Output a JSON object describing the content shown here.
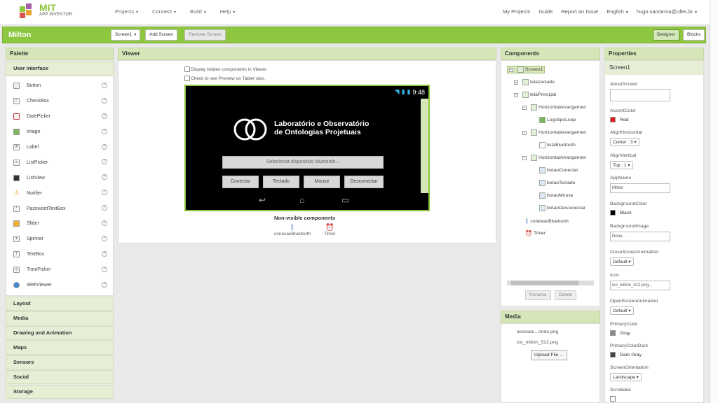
{
  "header": {
    "logo_text": "MIT",
    "logo_sub": "APP INVENTOR",
    "nav_left": [
      "Projects",
      "Connect",
      "Build",
      "Help"
    ],
    "nav_right": [
      "My Projects",
      "Guide",
      "Report an Issue",
      "English",
      "hugo.santanna@ufes.br"
    ]
  },
  "toolbar": {
    "project_name": "Milton",
    "screen_select": "Screen1",
    "add_screen": "Add Screen",
    "remove_screen": "Remove Screen",
    "designer": "Designer",
    "blocks": "Blocks"
  },
  "palette": {
    "title": "Palette",
    "open_category": "User Interface",
    "items": [
      {
        "label": "Button",
        "icon": "button-icon"
      },
      {
        "label": "CheckBox",
        "icon": "checkbox-icon"
      },
      {
        "label": "DatePicker",
        "icon": "datepicker-icon"
      },
      {
        "label": "Image",
        "icon": "image-icon"
      },
      {
        "label": "Label",
        "icon": "label-icon"
      },
      {
        "label": "ListPicker",
        "icon": "listpicker-icon"
      },
      {
        "label": "ListView",
        "icon": "listview-icon"
      },
      {
        "label": "Notifier",
        "icon": "notifier-icon"
      },
      {
        "label": "PasswordTextBox",
        "icon": "password-icon"
      },
      {
        "label": "Slider",
        "icon": "slider-icon"
      },
      {
        "label": "Spinner",
        "icon": "spinner-icon"
      },
      {
        "label": "TextBox",
        "icon": "textbox-icon"
      },
      {
        "label": "TimePicker",
        "icon": "timepicker-icon"
      },
      {
        "label": "WebViewer",
        "icon": "webviewer-icon"
      }
    ],
    "categories": [
      "Layout",
      "Media",
      "Drawing and Animation",
      "Maps",
      "Sensors",
      "Social",
      "Storage"
    ]
  },
  "viewer": {
    "title": "Viewer",
    "chk_hidden": "Display hidden components in Viewer",
    "chk_tablet": "Check to see Preview on Tablet size.",
    "time": "9:48",
    "lab_line1": "Laboratório e Observatório",
    "lab_line2": "de Ontologias Projetuais",
    "select_bt": "Selecionar dispositivo bluetooth...",
    "buttons": [
      "Conectar",
      "Teclado",
      "Mouse",
      "Desconectar"
    ],
    "nonvisible_title": "Non-visible components",
    "nonvisible": [
      "conexaoBluetooth",
      "Timer"
    ]
  },
  "components": {
    "title": "Components",
    "tree": [
      "Screen1",
      "tela1eclado",
      "telaPrincipal",
      "HorizontalArrangemen",
      "LogotipoLoop",
      "HorizontalArrangemen",
      "listaBluetooth",
      "HorizontalArrangemen",
      "botaoConectar",
      "botaoTeclado",
      "botaoMouse",
      "botaoDesconectar",
      "conexaoBluetooth",
      "Timer"
    ],
    "rename": "Rename",
    "delete": "Delete"
  },
  "media": {
    "title": "Media",
    "files": [
      "assinatu...ondo.png",
      "ico_milton_512.png"
    ],
    "upload": "Upload File ..."
  },
  "properties": {
    "title": "Properties",
    "component": "Screen1",
    "AboutScreen": "AboutScreen",
    "AccentColor": "AccentColor",
    "accent_val": "Red",
    "AlignHorizontal": "AlignHorizontal",
    "alignh_val": "Center : 3",
    "AlignVertical": "AlignVertical",
    "alignv_val": "Top : 1",
    "AppName": "AppName",
    "appname_val": "Milton",
    "BackgroundColor": "BackgroundColor",
    "bg_val": "Black",
    "BackgroundImage": "BackgroundImage",
    "bgimg_val": "None...",
    "CloseScreenAnimation": "CloseScreenAnimation",
    "close_val": "Default",
    "Icon": "Icon",
    "icon_val": "ico_milton_512.png...",
    "OpenScreenAnimation": "OpenScreenAnimation",
    "open_val": "Default",
    "PrimaryColor": "PrimaryColor",
    "primary_val": "Gray",
    "PrimaryColorDark": "PrimaryColorDark",
    "primarydark_val": "Dark Gray",
    "ScreenOrientation": "ScreenOrientation",
    "orient_val": "Landscape",
    "Scrollable": "Scrollable"
  },
  "colors": {
    "accent": "#8dc63f",
    "red": "#e31b1b",
    "black": "#000000",
    "gray": "#888888",
    "darkgray": "#444444"
  }
}
